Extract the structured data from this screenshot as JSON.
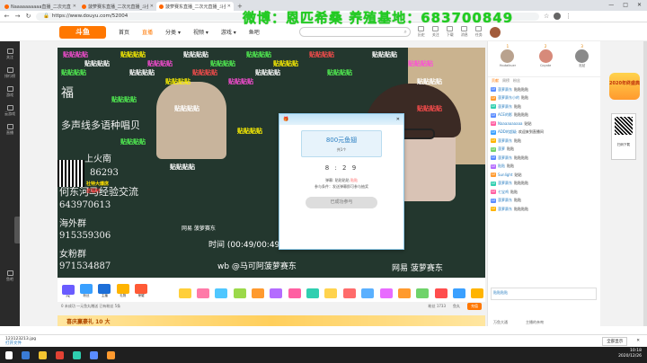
{
  "browser": {
    "tabs": [
      {
        "title": "Naaaaaaaaaa直播_二次元直..."
      },
      {
        "title": "菠萝赛东直播_二次元直播_斗鱼..."
      },
      {
        "title": "菠萝赛东直播_二次元直播_斗鱼..."
      }
    ],
    "url": "https://www.douyu.com/52004",
    "new_tab": "+",
    "controls": {
      "min": "—",
      "max": "□",
      "close": "✕"
    }
  },
  "watermark": "微博：恩匹希桑 养殖基地：683700849",
  "site": {
    "logo": "斗鱼",
    "nav": [
      "首页",
      "直播",
      "分类 ▾",
      "视频 ▾",
      "游戏 ▾",
      "鱼吧"
    ],
    "search_icon": "search-icon",
    "header_icons": [
      "历史",
      "关注",
      "下载",
      "消息",
      "任务"
    ]
  },
  "sidebar": {
    "items": [
      "关注",
      "排行榜",
      "游戏",
      "云游戏",
      "直播",
      "鱼吧"
    ]
  },
  "stream": {
    "chalk_lines": [
      "福",
      "多声线多语种唱贝",
      "上火南",
      "86293",
      "何东河马经验交流",
      "643970613",
      "海外群",
      "915359306",
      "女粉群",
      "971534887"
    ],
    "danmu": "贴贴贴贴",
    "schedule_text": "时间 (00:49/00:49) 出席",
    "wb_text": "wb @马可阿菠萝赛东",
    "netease": "网易 菠萝赛东",
    "qr_caption": "社特大爆席",
    "qr_name": "送福利"
  },
  "popup": {
    "prize": "800元鱼翅",
    "count": "共1个",
    "timer": "8 : 2 9",
    "condition_prefix": "弹幕:",
    "condition": "贴贴贴贴",
    "condition_tag": "贴贴",
    "info": "参与条件：发送弹幕即可参与抽奖",
    "button": "已成功参与"
  },
  "gifts": [
    "PK",
    "粉丝",
    "主播",
    "礼物",
    "荣耀",
    "",
    "",
    "",
    "",
    "",
    "",
    "",
    "",
    "",
    "",
    "",
    "",
    "",
    ""
  ],
  "bottom_bar": {
    "left": "0 未成功 一元鱼丸赠送 已有粉丝 5条",
    "fans": "粉丝 1733",
    "balance": "鱼丸",
    "recharge": "充值"
  },
  "banner": [
    "喜庆赢豪礼 10 大",
    "",
    ""
  ],
  "chat": {
    "ranks": [
      {
        "name": "Youtaikuer",
        "label": "1"
      },
      {
        "name": "Coyote",
        "label": "2"
      },
      {
        "name": "贴贴",
        "label": "3"
      }
    ],
    "tabs": [
      "贡献",
      "周榜",
      "粉丝"
    ],
    "messages": [
      {
        "user": "菠萝赛东",
        "text": "贴贴贴贴"
      },
      {
        "user": "菠萝赛东小的",
        "text": "贴贴"
      },
      {
        "user": "菠萝赛东",
        "text": "贴贴"
      },
      {
        "user": "ACE的影",
        "text": "贴贴贴贴"
      },
      {
        "user": "Naaaaaaaaaa",
        "text": "贴贴"
      },
      {
        "user": "ADD的超级",
        "text": "欢迎来到直播间"
      },
      {
        "user": "菠萝赛东",
        "text": "贴贴"
      },
      {
        "user": "菠萝",
        "text": "贴贴"
      },
      {
        "user": "菠萝赛东",
        "text": "贴贴贴贴"
      },
      {
        "user": "贴贴",
        "text": "贴贴"
      },
      {
        "user": "Sunlight",
        "text": "贴贴"
      },
      {
        "user": "菠萝赛东",
        "text": "贴贴贴贴"
      },
      {
        "user": "七宝鸡",
        "text": "贴贴"
      },
      {
        "user": "菠萝赛东",
        "text": "贴贴"
      },
      {
        "user": "菠萝赛东",
        "text": "贴贴贴贴"
      }
    ],
    "input": "贴贴贴贴",
    "bottom": [
      "万鱼大通",
      "主播的亲吻"
    ]
  },
  "right_column": {
    "ad": "2020年终盛典",
    "qr_label": "扫码下载"
  },
  "download": {
    "file": "123123213.jpg",
    "sub": "打开文件",
    "show_all": "全部显示",
    "close": "✕"
  },
  "taskbar": {
    "time": "10:18",
    "date": "2020/12/26"
  },
  "colors": {
    "brand": "#ff7700",
    "watermark": "#22cc22",
    "chalkboard": "#23372e"
  }
}
